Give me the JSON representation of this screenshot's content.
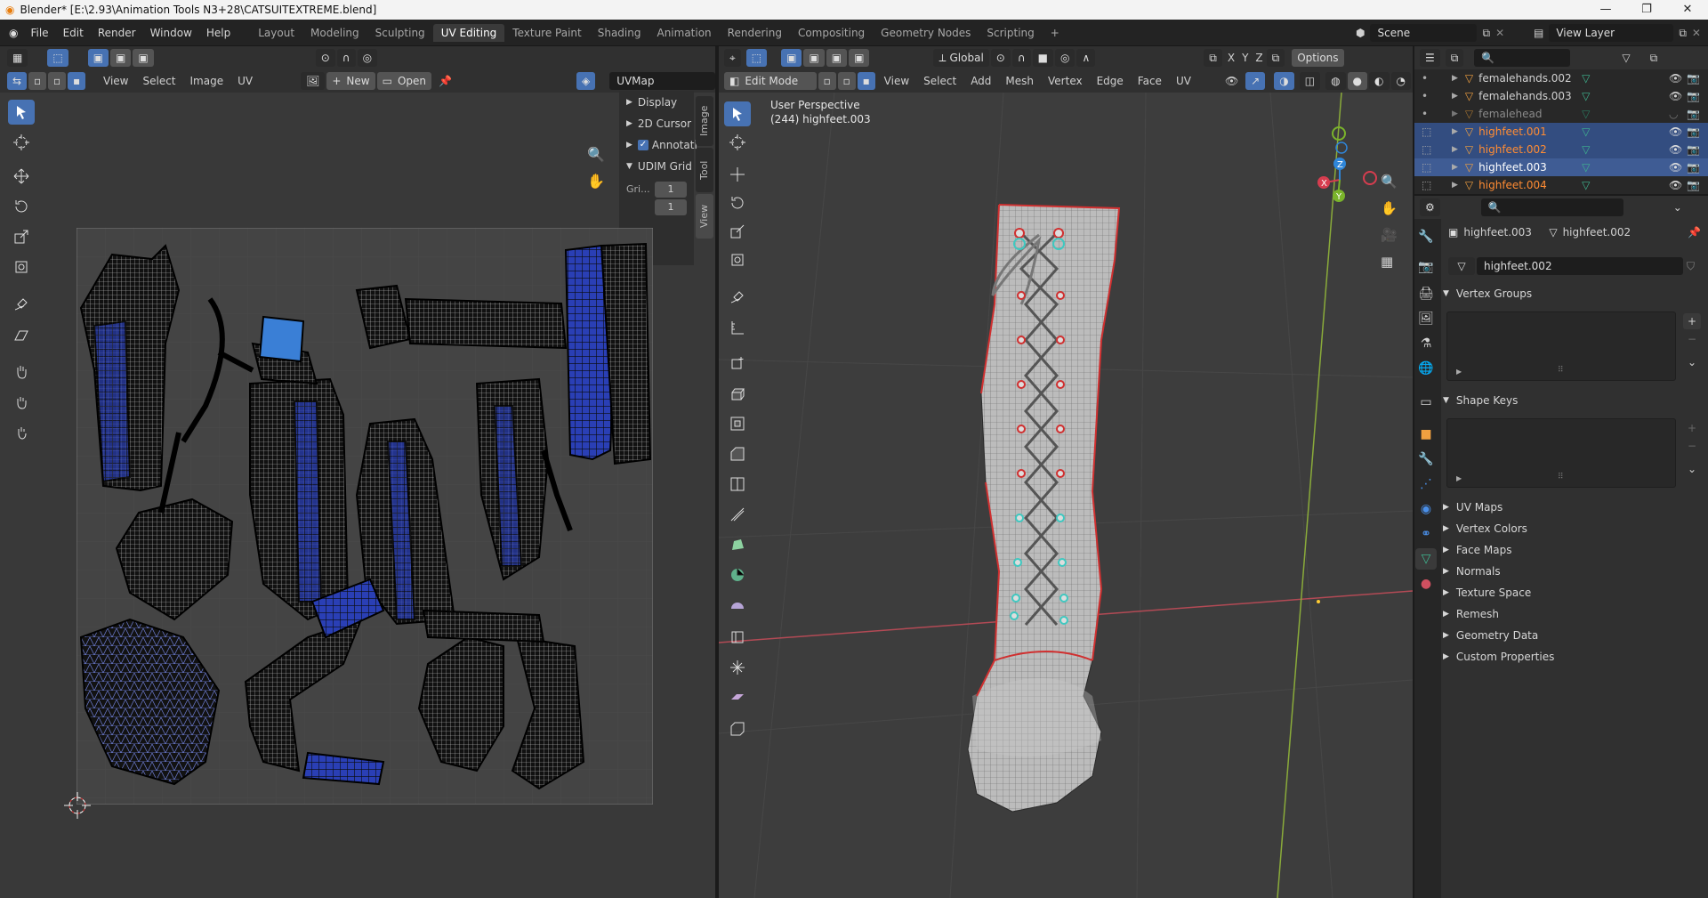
{
  "window": {
    "title": "Blender* [E:\\2.93\\Animation Tools N3+28\\CATSUITEXTREME.blend]",
    "minimize": "—",
    "maximize": "❐",
    "close": "✕"
  },
  "menubar": {
    "items": [
      "File",
      "Edit",
      "Render",
      "Window",
      "Help"
    ]
  },
  "workspaces": [
    {
      "label": "Layout",
      "active": false
    },
    {
      "label": "Modeling",
      "active": false
    },
    {
      "label": "Sculpting",
      "active": false
    },
    {
      "label": "UV Editing",
      "active": true
    },
    {
      "label": "Texture Paint",
      "active": false
    },
    {
      "label": "Shading",
      "active": false
    },
    {
      "label": "Animation",
      "active": false
    },
    {
      "label": "Rendering",
      "active": false
    },
    {
      "label": "Compositing",
      "active": false
    },
    {
      "label": "Geometry Nodes",
      "active": false
    },
    {
      "label": "Scripting",
      "active": false
    }
  ],
  "add_workspace": "+",
  "scene": {
    "value": "Scene"
  },
  "view_layer": {
    "value": "View Layer"
  },
  "uv_editor": {
    "menus": [
      "View",
      "Select",
      "Image",
      "UV"
    ],
    "new_label": "New",
    "open_label": "Open",
    "uvmap": "UVMap",
    "npanel": {
      "display": "Display",
      "cursor": "2D Cursor",
      "annotations": "Annotati",
      "udim": "UDIM Grid",
      "grid_label": "Gri...",
      "grid_x": "1",
      "grid_y": "1"
    },
    "side_tabs": [
      "Image",
      "Tool",
      "View"
    ]
  },
  "viewport": {
    "orientation": "Global",
    "options": "Options",
    "mode": "Edit Mode",
    "menus": [
      "View",
      "Select",
      "Add",
      "Mesh",
      "Vertex",
      "Edge",
      "Face",
      "UV"
    ],
    "overlay_line1": "User Perspective",
    "overlay_line2": "(244) highfeet.003",
    "axes": {
      "x": "X",
      "y": "Y",
      "z": "Z"
    },
    "axis_toggles": [
      "X",
      "Y",
      "Z"
    ]
  },
  "outliner": {
    "rows": [
      {
        "name": "femalehands.002",
        "selected": false,
        "dim": false
      },
      {
        "name": "femalehands.003",
        "selected": false,
        "dim": false
      },
      {
        "name": "femalehead",
        "selected": false,
        "dim": true
      },
      {
        "name": "highfeet.001",
        "selected": true,
        "dim": false
      },
      {
        "name": "highfeet.002",
        "selected": true,
        "dim": false
      },
      {
        "name": "highfeet.003",
        "selected": true,
        "dim": false
      },
      {
        "name": "highfeet.004",
        "selected": false,
        "dim": false
      }
    ]
  },
  "properties": {
    "breadcrumb_object": "highfeet.003",
    "breadcrumb_mesh": "highfeet.002",
    "mesh_name": "highfeet.002",
    "panels_open": [
      "Vertex Groups",
      "Shape Keys"
    ],
    "panels_closed": [
      "UV Maps",
      "Vertex Colors",
      "Face Maps",
      "Normals",
      "Texture Space",
      "Remesh",
      "Geometry Data",
      "Custom Properties"
    ]
  },
  "colors": {
    "accent": "#4772b3",
    "selected_text": "#ff8c33",
    "mesh_green": "#3fb58f",
    "x_axis": "#d63d4f",
    "y_axis": "#7ab42b",
    "z_axis": "#2f86d9"
  }
}
